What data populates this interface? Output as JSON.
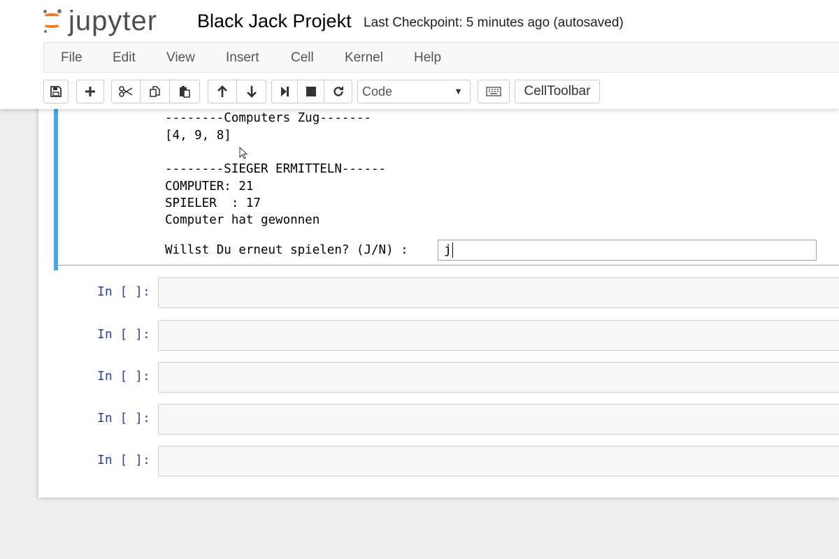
{
  "header": {
    "logo_text": "jupyter",
    "notebook_name": "Black Jack Projekt",
    "checkpoint": "Last Checkpoint: 5 minutes ago (autosaved)"
  },
  "menu": [
    "File",
    "Edit",
    "View",
    "Insert",
    "Cell",
    "Kernel",
    "Help"
  ],
  "toolbar": {
    "buttons": [
      "save-icon",
      "plus-icon",
      "scissors-icon",
      "copy-icon",
      "paste-icon",
      "arrow-up-icon",
      "arrow-down-icon",
      "step-forward-icon",
      "stop-icon",
      "refresh-icon",
      "keyboard-icon"
    ],
    "cell_type": "Code",
    "celltoolbar_label": "CellToolbar"
  },
  "active_cell": {
    "output_lines": [
      "--------Computers Zug-------",
      "[4, 9, 8]",
      "",
      "--------SIEGER ERMITTELN------",
      "COMPUTER: 21",
      "SPIELER  : 17",
      "Computer hat gewonnen"
    ],
    "stdin_prompt": "Willst Du erneut spielen? (J/N) :",
    "stdin_value": "j"
  },
  "empty_cells": [
    {
      "prompt": "In [ ]:"
    },
    {
      "prompt": "In [ ]:"
    },
    {
      "prompt": "In [ ]:"
    },
    {
      "prompt": "In [ ]:"
    },
    {
      "prompt": "In [ ]:"
    }
  ],
  "colors": {
    "accent_orange": "#f37726",
    "active_cell_bar": "#42a5f5",
    "prompt_blue": "#303f9f"
  }
}
